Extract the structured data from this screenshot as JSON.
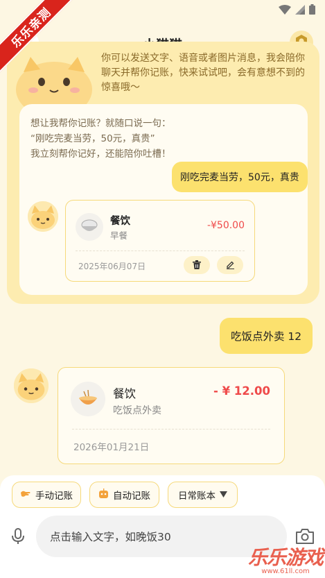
{
  "ribbon": {
    "text": "乐乐亲测"
  },
  "header": {
    "title": "小猫猫",
    "back_icon": "back-arrow-icon",
    "settings_icon": "hexagon-settings-icon"
  },
  "intro": {
    "text": "你可以发送文字、语音或者图片消息，我会陪你聊天并帮你记账，快来试试吧，会有意想不到的惊喜哦～",
    "prompt_lines": [
      "想让我帮你记账？就随口说一句：",
      "“刚吃完麦当劳，50元，真贵”",
      "我立刻帮你记好，还能陪你吐槽！"
    ],
    "example_bubble": "刚吃完麦当劳，50元，真贵",
    "example_record": {
      "category": "餐饮",
      "subcategory": "早餐",
      "amount": "-¥50.00",
      "date": "2025年06月07日"
    }
  },
  "chat": {
    "user_message": "吃饭点外卖 12",
    "record": {
      "category": "餐饮",
      "subcategory": "吃饭点外卖",
      "amount": "- ¥ 12.00",
      "date": "2026年01月21日"
    }
  },
  "toolbar": {
    "chips": [
      {
        "label": "手动记账",
        "icon": "hand-icon"
      },
      {
        "label": "自动记账",
        "icon": "robot-icon"
      },
      {
        "label": "日常账本",
        "icon": "caret-down-icon"
      }
    ],
    "input_placeholder": "点击输入文字，如晚饭30"
  },
  "watermark": {
    "main": "乐乐游戏",
    "sub": "www.61ll.com"
  },
  "colors": {
    "accent": "#fce16e",
    "amount": "#ef4a4a",
    "background": "#fdf7e3"
  }
}
